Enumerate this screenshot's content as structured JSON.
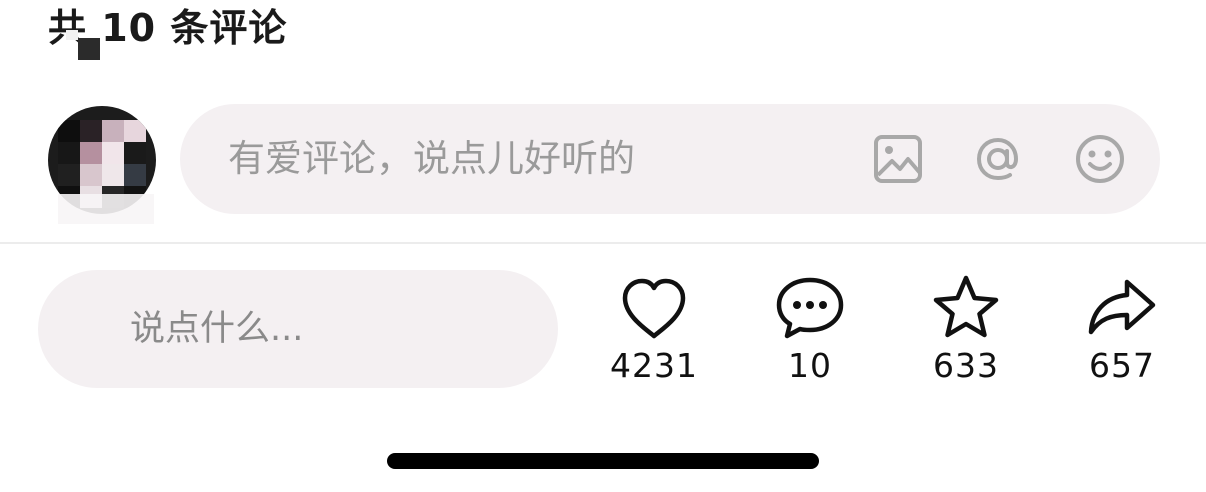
{
  "header": {
    "title": "共 10 条评论"
  },
  "comment_input": {
    "placeholder": "有爱评论，说点儿好听的",
    "icons": [
      "image-icon",
      "at-icon",
      "emoji-icon"
    ]
  },
  "bottom_bar": {
    "input_placeholder": "说点什么...",
    "actions": [
      {
        "icon": "heart-icon",
        "count": "4231"
      },
      {
        "icon": "comment-bubble-icon",
        "count": "10"
      },
      {
        "icon": "star-icon",
        "count": "633"
      },
      {
        "icon": "share-icon",
        "count": "657"
      }
    ]
  },
  "colors": {
    "input_bg": "#f4f0f2",
    "placeholder": "#9a9a9a",
    "icon": "#a8a8a8",
    "text": "#1a1a1a"
  }
}
